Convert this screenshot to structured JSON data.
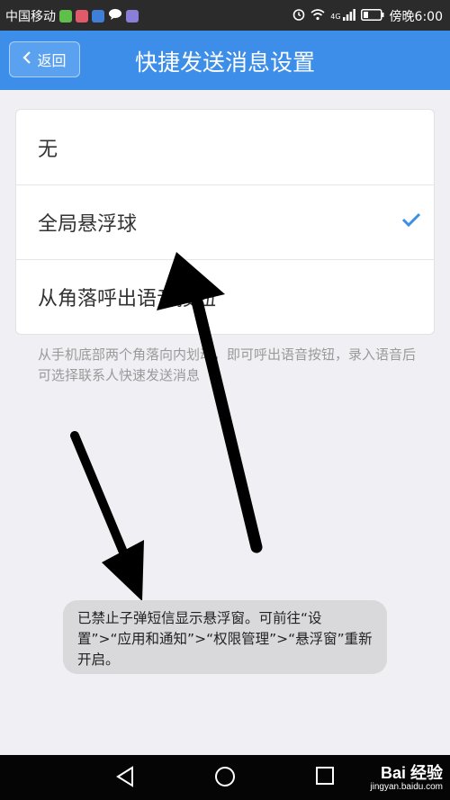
{
  "status_bar": {
    "carrier": "中国移动",
    "network": "4G",
    "time": "傍晚6:00"
  },
  "header": {
    "back_label": "返回",
    "title": "快捷发送消息设置"
  },
  "options": [
    {
      "label": "无",
      "selected": false
    },
    {
      "label": "全局悬浮球",
      "selected": true
    },
    {
      "label": "从角落呼出语音按钮",
      "selected": false
    }
  ],
  "description": "从手机底部两个角落向内划动，即可呼出语音按钮，录入语音后可选择联系人快速发送消息",
  "toast": "已禁止子弹短信显示悬浮窗。可前往“设置”>“应用和通知”>“权限管理”>“悬浮窗”重新开启。",
  "watermark": {
    "main": "Bai 经验",
    "sub": "jingyan.baidu.com"
  },
  "colors": {
    "accent": "#3d8ee8",
    "check": "#3d8ee8"
  }
}
